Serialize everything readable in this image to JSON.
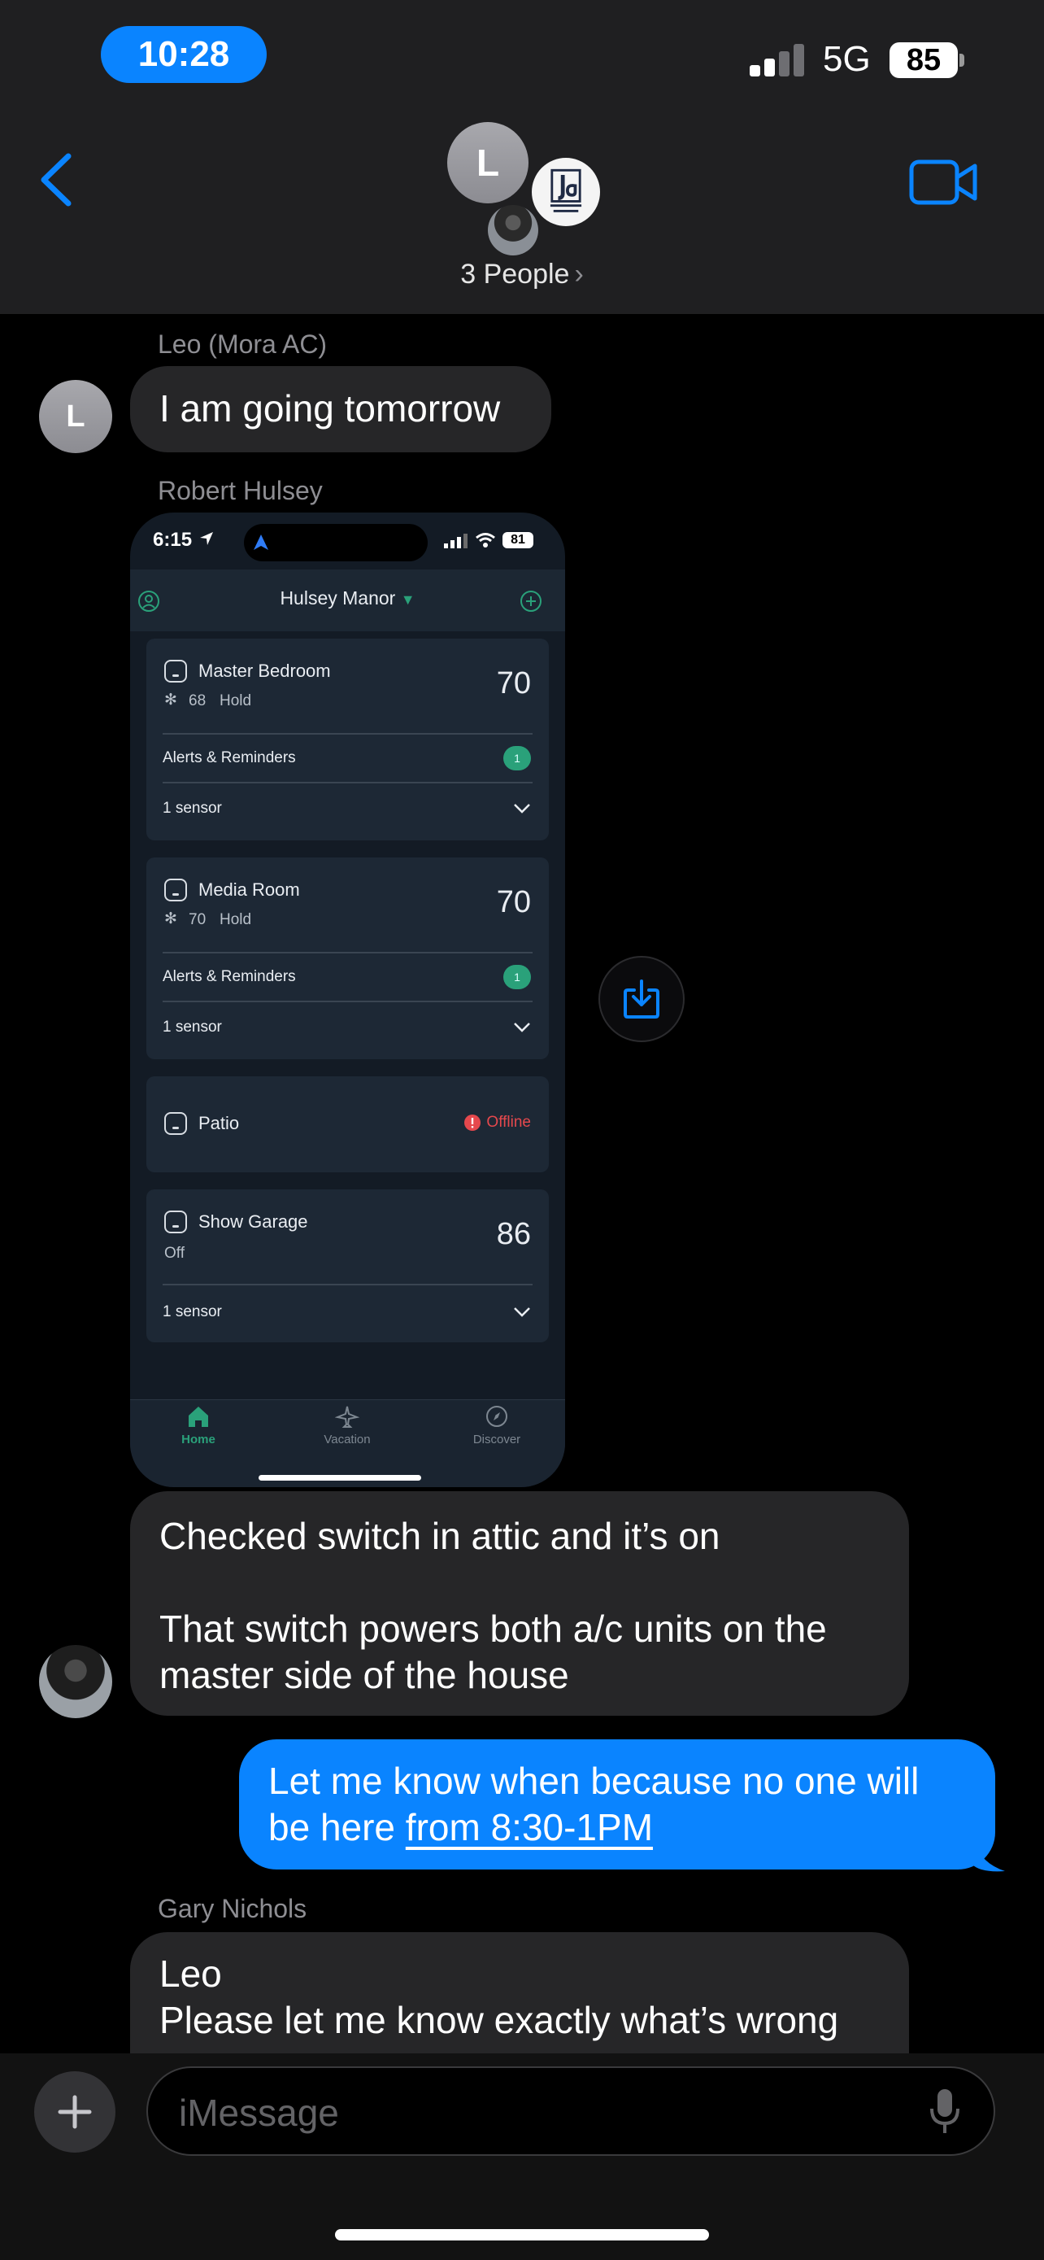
{
  "status_bar": {
    "time": "10:28",
    "network": "5G",
    "battery": "85"
  },
  "header": {
    "group_avatar_letter": "L",
    "people_label": "3 People",
    "chevron": "›"
  },
  "messages": [
    {
      "sender": "Leo (Mora AC)",
      "avatar_letter": "L",
      "text": "I am going tomorrow"
    },
    {
      "sender": "Robert Hulsey"
    },
    {
      "lines": [
        "Checked switch in attic and it’s on",
        "",
        "That switch powers both a/c units on the",
        "master side of the house"
      ]
    },
    {
      "outgoing": true,
      "line1": "Let me know when because no one will",
      "line2_prefix": "be here ",
      "line2_link": "from 8:30-1PM"
    },
    {
      "sender": "Gary Nichols",
      "lines": [
        "Leo",
        "Please let me know exactly what’s wrong"
      ]
    }
  ],
  "screenshot": {
    "time": "6:15",
    "battery": "81",
    "home_name": "Hulsey Manor",
    "rooms": [
      {
        "name": "Master Bedroom",
        "setpoint": "68",
        "mode": "Hold",
        "temp": "70",
        "alerts_label": "Alerts & Reminders",
        "alerts_count": "1",
        "sensor_label": "1 sensor"
      },
      {
        "name": "Media Room",
        "setpoint": "70",
        "mode": "Hold",
        "temp": "70",
        "alerts_label": "Alerts & Reminders",
        "alerts_count": "1",
        "sensor_label": "1 sensor"
      },
      {
        "name": "Patio",
        "status": "Offline"
      },
      {
        "name": "Show Garage",
        "mode": "Off",
        "temp": "86",
        "sensor_label": "1 sensor"
      }
    ],
    "tabs": [
      "Home",
      "Vacation",
      "Discover"
    ]
  },
  "compose": {
    "placeholder": "iMessage"
  },
  "colors": {
    "imessage_blue": "#0a84ff",
    "incoming_bubble": "#262628",
    "app_green": "#2aa17a",
    "offline_red": "#e5484d"
  }
}
